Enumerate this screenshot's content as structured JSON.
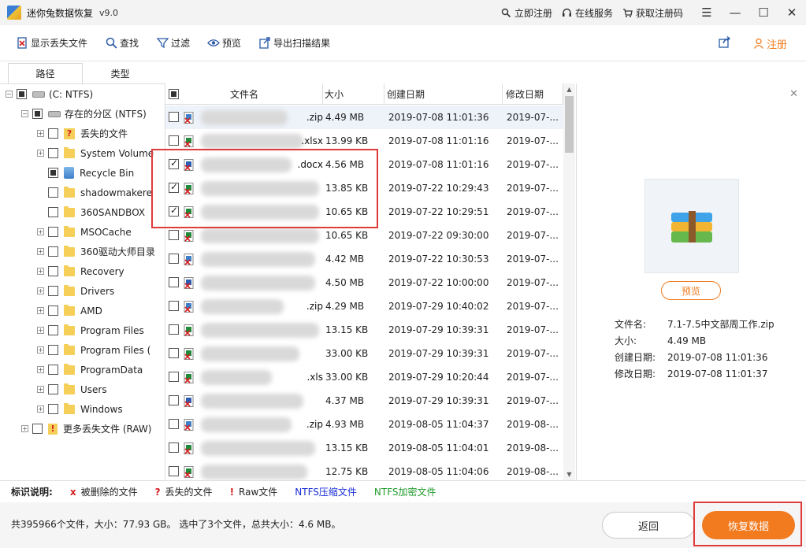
{
  "titlebar": {
    "title": "迷你兔数据恢复",
    "version": "v9.0",
    "links": [
      {
        "label": "立即注册",
        "icon": "search-person-icon"
      },
      {
        "label": "在线服务",
        "icon": "headset-icon"
      },
      {
        "label": "获取注册码",
        "icon": "cart-icon"
      }
    ],
    "window_buttons": {
      "menu": "☰",
      "minimize": "—",
      "maximize": "☐",
      "close": "✕"
    }
  },
  "toolbar": {
    "items": [
      {
        "label": "显示丢失文件",
        "icon": "show-lost-files-icon"
      },
      {
        "label": "查找",
        "icon": "search-icon"
      },
      {
        "label": "过滤",
        "icon": "filter-icon"
      },
      {
        "label": "预览",
        "icon": "eye-icon"
      },
      {
        "label": "导出扫描结果",
        "icon": "export-icon"
      }
    ],
    "share_icon": "share-icon",
    "register_label": "注册"
  },
  "tabs": {
    "path": "路径",
    "type": "类型"
  },
  "tree": [
    {
      "label": "(C: NTFS)",
      "kind": "drive"
    },
    {
      "label": "存在的分区 (NTFS)",
      "kind": "drive"
    },
    {
      "label": "丢失的文件",
      "kind": "lost"
    },
    {
      "label": "System Volume",
      "kind": "folder"
    },
    {
      "label": "Recycle Bin",
      "kind": "recycle"
    },
    {
      "label": "shadowmakere",
      "kind": "folder"
    },
    {
      "label": "360SANDBOX",
      "kind": "folder"
    },
    {
      "label": "MSOCache",
      "kind": "folder"
    },
    {
      "label": "360驱动大师目录",
      "kind": "folder"
    },
    {
      "label": "Recovery",
      "kind": "folder"
    },
    {
      "label": "Drivers",
      "kind": "folder"
    },
    {
      "label": "AMD",
      "kind": "folder"
    },
    {
      "label": "Program Files",
      "kind": "folder"
    },
    {
      "label": "Program Files (",
      "kind": "folder"
    },
    {
      "label": "ProgramData",
      "kind": "folder"
    },
    {
      "label": "Users",
      "kind": "folder"
    },
    {
      "label": "Windows",
      "kind": "folder"
    },
    {
      "label": "更多丢失文件 (RAW)",
      "kind": "raw"
    }
  ],
  "list": {
    "columns": {
      "name": "文件名",
      "size": "大小",
      "created": "创建日期",
      "modified": "修改日期"
    },
    "rows": [
      {
        "name_suffix": ".zip",
        "size": "4.49 MB",
        "created": "2019-07-08 11:01:36",
        "modified": "2019-07-...",
        "checked": false,
        "type": "zip"
      },
      {
        "name_suffix": ".xlsx",
        "size": "13.99 KB",
        "created": "2019-07-08 11:01:16",
        "modified": "2019-07-...",
        "checked": false,
        "type": "xls"
      },
      {
        "name_suffix": ".docx",
        "size": "4.56 MB",
        "created": "2019-07-08 11:01:16",
        "modified": "2019-07-...",
        "checked": true,
        "type": "doc"
      },
      {
        "name_suffix": "",
        "size": "13.85 KB",
        "created": "2019-07-22 10:29:43",
        "modified": "2019-07-...",
        "checked": true,
        "type": "xls"
      },
      {
        "name_suffix": "",
        "size": "10.65 KB",
        "created": "2019-07-22 10:29:51",
        "modified": "2019-07-...",
        "checked": true,
        "type": "xls"
      },
      {
        "name_suffix": "",
        "size": "10.65 KB",
        "created": "2019-07-22 09:30:00",
        "modified": "2019-07-...",
        "checked": false,
        "type": "xls"
      },
      {
        "name_suffix": "",
        "size": "4.42 MB",
        "created": "2019-07-22 10:30:53",
        "modified": "2019-07-...",
        "checked": false,
        "type": "zip"
      },
      {
        "name_suffix": "",
        "size": "4.50 MB",
        "created": "2019-07-22 10:00:00",
        "modified": "2019-07-...",
        "checked": false,
        "type": "doc"
      },
      {
        "name_suffix": ".zip",
        "size": "4.29 MB",
        "created": "2019-07-29 10:40:02",
        "modified": "2019-07-...",
        "checked": false,
        "type": "zip"
      },
      {
        "name_suffix": "",
        "size": "13.15 KB",
        "created": "2019-07-29 10:39:31",
        "modified": "2019-07-...",
        "checked": false,
        "type": "xls"
      },
      {
        "name_suffix": "",
        "size": "33.00 KB",
        "created": "2019-07-29 10:39:31",
        "modified": "2019-07-...",
        "checked": false,
        "type": "xls"
      },
      {
        "name_suffix": ".xls",
        "size": "33.00 KB",
        "created": "2019-07-29 10:20:44",
        "modified": "2019-07-...",
        "checked": false,
        "type": "xls"
      },
      {
        "name_suffix": "",
        "size": "4.37 MB",
        "created": "2019-07-29 10:39:31",
        "modified": "2019-07-...",
        "checked": false,
        "type": "doc"
      },
      {
        "name_suffix": ".zip",
        "size": "4.93 MB",
        "created": "2019-08-05 11:04:37",
        "modified": "2019-08-...",
        "checked": false,
        "type": "zip"
      },
      {
        "name_suffix": "",
        "size": "13.15 KB",
        "created": "2019-08-05 11:04:01",
        "modified": "2019-08-...",
        "checked": false,
        "type": "xls"
      },
      {
        "name_suffix": "",
        "size": "12.75 KB",
        "created": "2019-08-05 11:04:06",
        "modified": "2019-08-...",
        "checked": false,
        "type": "xls"
      }
    ]
  },
  "preview": {
    "button": "预览",
    "fields": [
      {
        "key": "文件名:",
        "value": "7.1-7.5中文部周工作.zip"
      },
      {
        "key": "大小:",
        "value": "4.49 MB"
      },
      {
        "key": "创建日期:",
        "value": "2019-07-08 11:01:36"
      },
      {
        "key": "修改日期:",
        "value": "2019-07-08 11:01:37"
      }
    ]
  },
  "legend": {
    "title": "标识说明:",
    "items": [
      {
        "mark": "x",
        "label": "被删除的文件",
        "color": "#d42020"
      },
      {
        "mark": "?",
        "label": "丢失的文件",
        "color": "#d42020"
      },
      {
        "mark": "!",
        "label": "Raw文件",
        "color": "#d42020"
      },
      {
        "mark": "",
        "label": "NTFS压缩文件",
        "color": "#1a2fd6"
      },
      {
        "mark": "",
        "label": "NTFS加密文件",
        "color": "#1e9b2a"
      }
    ]
  },
  "status": {
    "text": "共395966个文件，大小：77.93 GB。 选中了3个文件，总共大小：4.6 MB。",
    "back": "返回",
    "recover": "恢复数据"
  },
  "colors": {
    "accent": "#f27a1f",
    "highlight_box": "#e03b3b"
  }
}
